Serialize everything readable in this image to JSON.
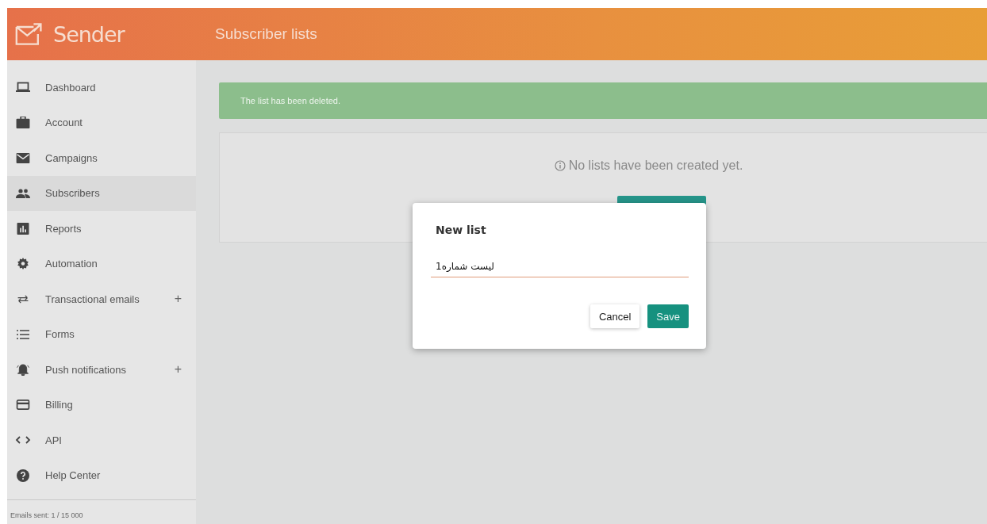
{
  "header": {
    "brand": "Sender",
    "title": "Subscriber lists"
  },
  "sidebar": {
    "items": [
      {
        "label": "Dashboard",
        "kind": "laptop",
        "selected": false
      },
      {
        "label": "Account",
        "kind": "briefcase",
        "selected": false
      },
      {
        "label": "Campaigns",
        "kind": "mail",
        "selected": false
      },
      {
        "label": "Subscribers",
        "kind": "people",
        "selected": true
      },
      {
        "label": "Reports",
        "kind": "chart",
        "selected": false
      },
      {
        "label": "Automation",
        "kind": "gear",
        "selected": false
      },
      {
        "label": "Transactional emails",
        "kind": "swap",
        "selected": false,
        "expand_symbol": "+"
      },
      {
        "label": "Forms",
        "kind": "list",
        "selected": false
      },
      {
        "label": "Push notifications",
        "kind": "bell",
        "selected": false,
        "expand_symbol": "+"
      },
      {
        "label": "Billing",
        "kind": "card",
        "selected": false
      },
      {
        "label": "API",
        "kind": "code",
        "selected": false
      },
      {
        "label": "Help Center",
        "kind": "help",
        "selected": false
      }
    ],
    "footer": "Emails sent: 1 / 15 000"
  },
  "alert": {
    "text": "The list has been deleted."
  },
  "empty_state": {
    "text": "No lists have been created yet."
  },
  "dialog": {
    "title": "New list",
    "input": {
      "value": "لیست شماره1"
    },
    "buttons": [
      {
        "label": "Cancel",
        "kind": "secondary"
      },
      {
        "label": "Save",
        "kind": "primary"
      }
    ]
  }
}
